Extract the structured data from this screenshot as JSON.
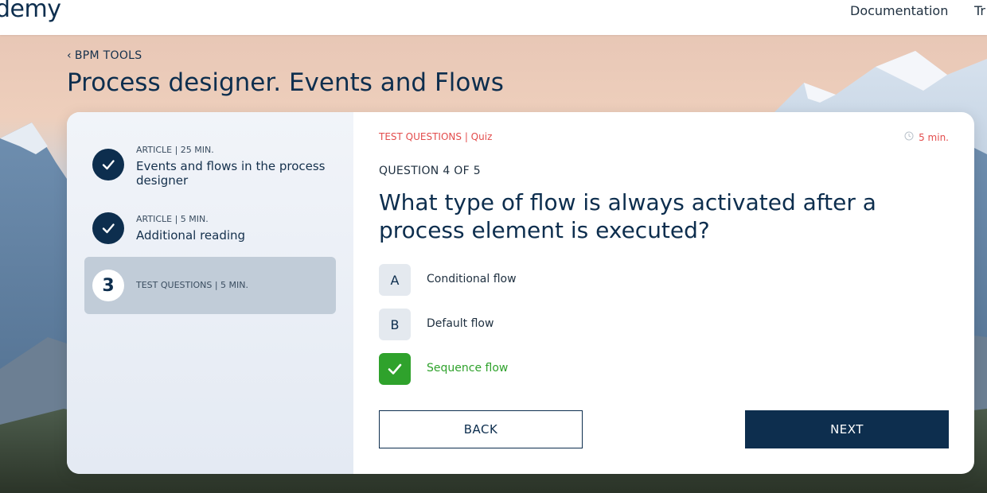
{
  "header": {
    "logo_text": "demy",
    "nav_items": [
      "Documentation",
      "Tr"
    ]
  },
  "breadcrumb": {
    "back_label": "BPM TOOLS"
  },
  "page_title": "Process designer. Events and Flows",
  "sidebar": {
    "steps": [
      {
        "meta": "ARTICLE | 25 MIN.",
        "title": "Events and flows in the process designer",
        "status": "completed"
      },
      {
        "meta": "ARTICLE | 5 MIN.",
        "title": "Additional reading",
        "status": "completed"
      },
      {
        "number": "3",
        "meta": "TEST QUESTIONS | 5 MIN.",
        "status": "active"
      }
    ]
  },
  "quiz": {
    "kicker": "TEST QUESTIONS | Quiz",
    "duration": "5 min.",
    "question_number": "QUESTION 4 OF 5",
    "question_line1": "What type of flow is always activated after a",
    "question_line2": "process element is executed?",
    "options": [
      {
        "letter": "A",
        "label": "Conditional flow",
        "state": "default"
      },
      {
        "letter": "B",
        "label": "Default flow",
        "state": "default"
      },
      {
        "letter": "",
        "label": "Sequence flow",
        "state": "correct"
      }
    ],
    "back_label": "BACK",
    "next_label": "NEXT"
  },
  "colors": {
    "brand_navy": "#0d2e4e",
    "accent_red": "#e34d4d",
    "correct_green": "#2fa22c"
  }
}
